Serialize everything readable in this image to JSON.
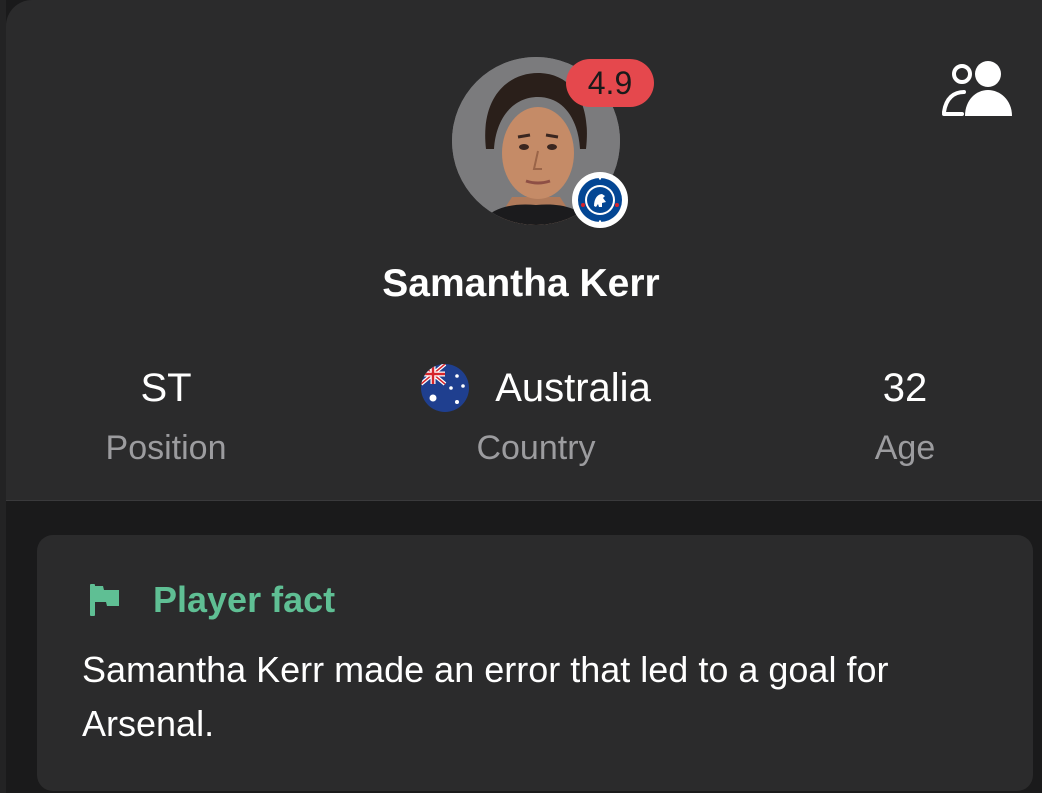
{
  "player": {
    "name": "Samantha Kerr",
    "rating": "4.9",
    "club_crest": "chelsea-crest"
  },
  "header": {
    "compare_icon": "people-compare-icon"
  },
  "stats": {
    "position": {
      "value": "ST",
      "label": "Position"
    },
    "country": {
      "value": "Australia",
      "label": "Country",
      "flag": "australia-flag"
    },
    "age": {
      "value": "32",
      "label": "Age"
    }
  },
  "fact": {
    "icon": "flag-icon",
    "title": "Player fact",
    "text": "Samantha Kerr made an error that led to a goal for Arsenal."
  },
  "colors": {
    "background": "#1a1a1b",
    "card": "#2b2b2c",
    "accent_green": "#5fbf94",
    "rating_red": "#e5484d",
    "muted_text": "#9c9c9f"
  }
}
